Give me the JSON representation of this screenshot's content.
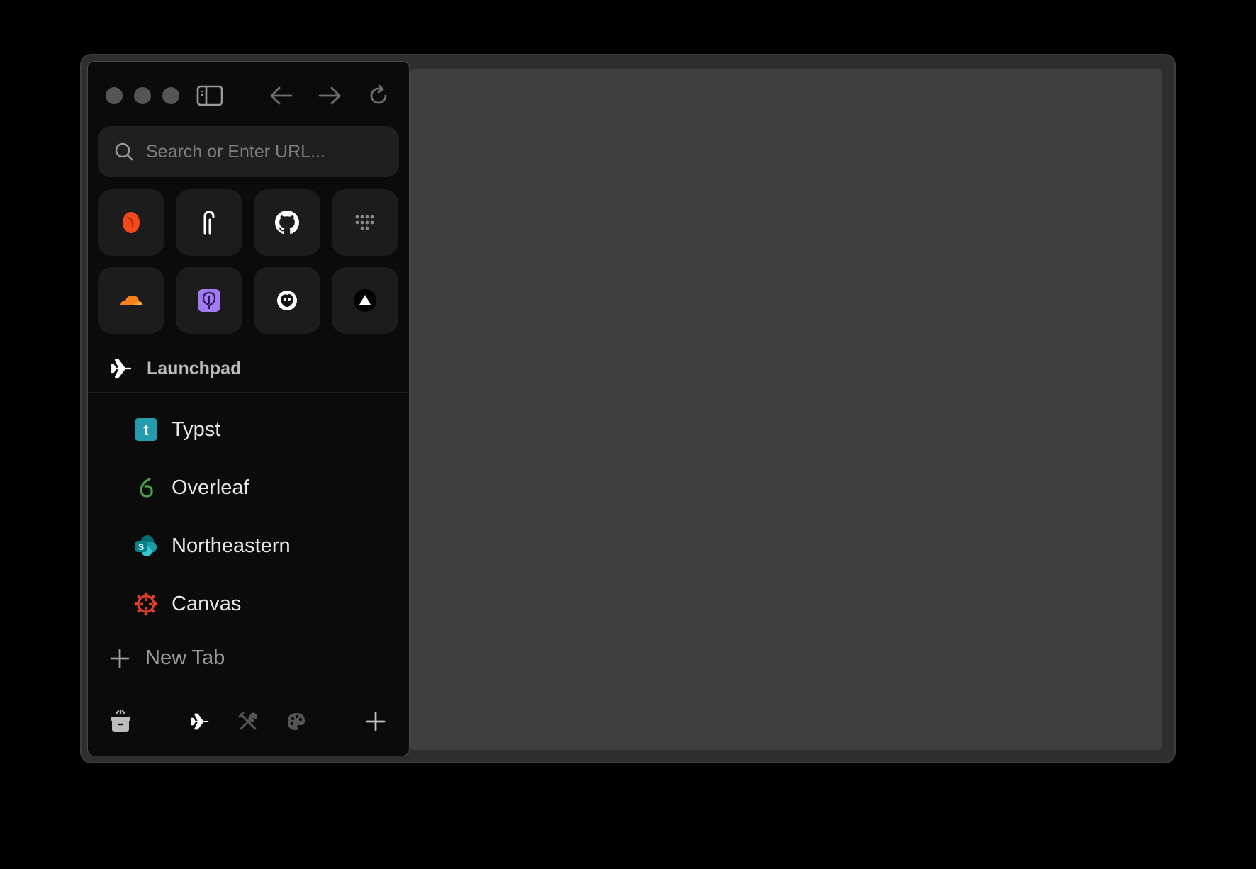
{
  "toolbar": {
    "traffic_lights": [
      "close",
      "minimize",
      "zoom"
    ],
    "sidebar_toggle_icon": "sidebar-icon",
    "back_icon": "arrow-left-icon",
    "forward_icon": "arrow-right-icon",
    "reload_icon": "reload-icon"
  },
  "search": {
    "placeholder": "Search or Enter URL..."
  },
  "favorites": [
    {
      "name": "favorite-1",
      "icon": "orange-swirl-icon",
      "color": "#f04a1c"
    },
    {
      "name": "favorite-2",
      "icon": "tall-glyph-icon",
      "color": "#ffffff"
    },
    {
      "name": "favorite-github",
      "icon": "github-icon",
      "color": "#ffffff"
    },
    {
      "name": "favorite-4",
      "icon": "dot-grid-icon",
      "color": "#9a9a9a"
    },
    {
      "name": "favorite-cloudflare",
      "icon": "cloudflare-icon",
      "color": "#f6821f"
    },
    {
      "name": "favorite-6",
      "icon": "purple-balloon-icon",
      "color": "#a07cf0"
    },
    {
      "name": "favorite-7",
      "icon": "monkey-icon",
      "color": "#ffffff"
    },
    {
      "name": "favorite-8",
      "icon": "triangle-icon",
      "color": "#ffffff"
    }
  ],
  "space": {
    "label": "Launchpad",
    "icon": "airplane-icon"
  },
  "tabs": [
    {
      "label": "Typst",
      "icon": "typst-icon",
      "color": "#239dad"
    },
    {
      "label": "Overleaf",
      "icon": "overleaf-icon",
      "color": "#47a141"
    },
    {
      "label": "Northeastern",
      "icon": "sharepoint-icon",
      "color": "#038387"
    },
    {
      "label": "Canvas",
      "icon": "canvas-icon",
      "color": "#e13f2b"
    }
  ],
  "new_tab": {
    "label": "New Tab",
    "icon": "plus-icon"
  },
  "bottom_bar": {
    "archive_icon": "archive-icon",
    "spaces": [
      "airplane-icon",
      "tools-icon",
      "palette-icon"
    ],
    "add_icon": "plus-icon"
  }
}
